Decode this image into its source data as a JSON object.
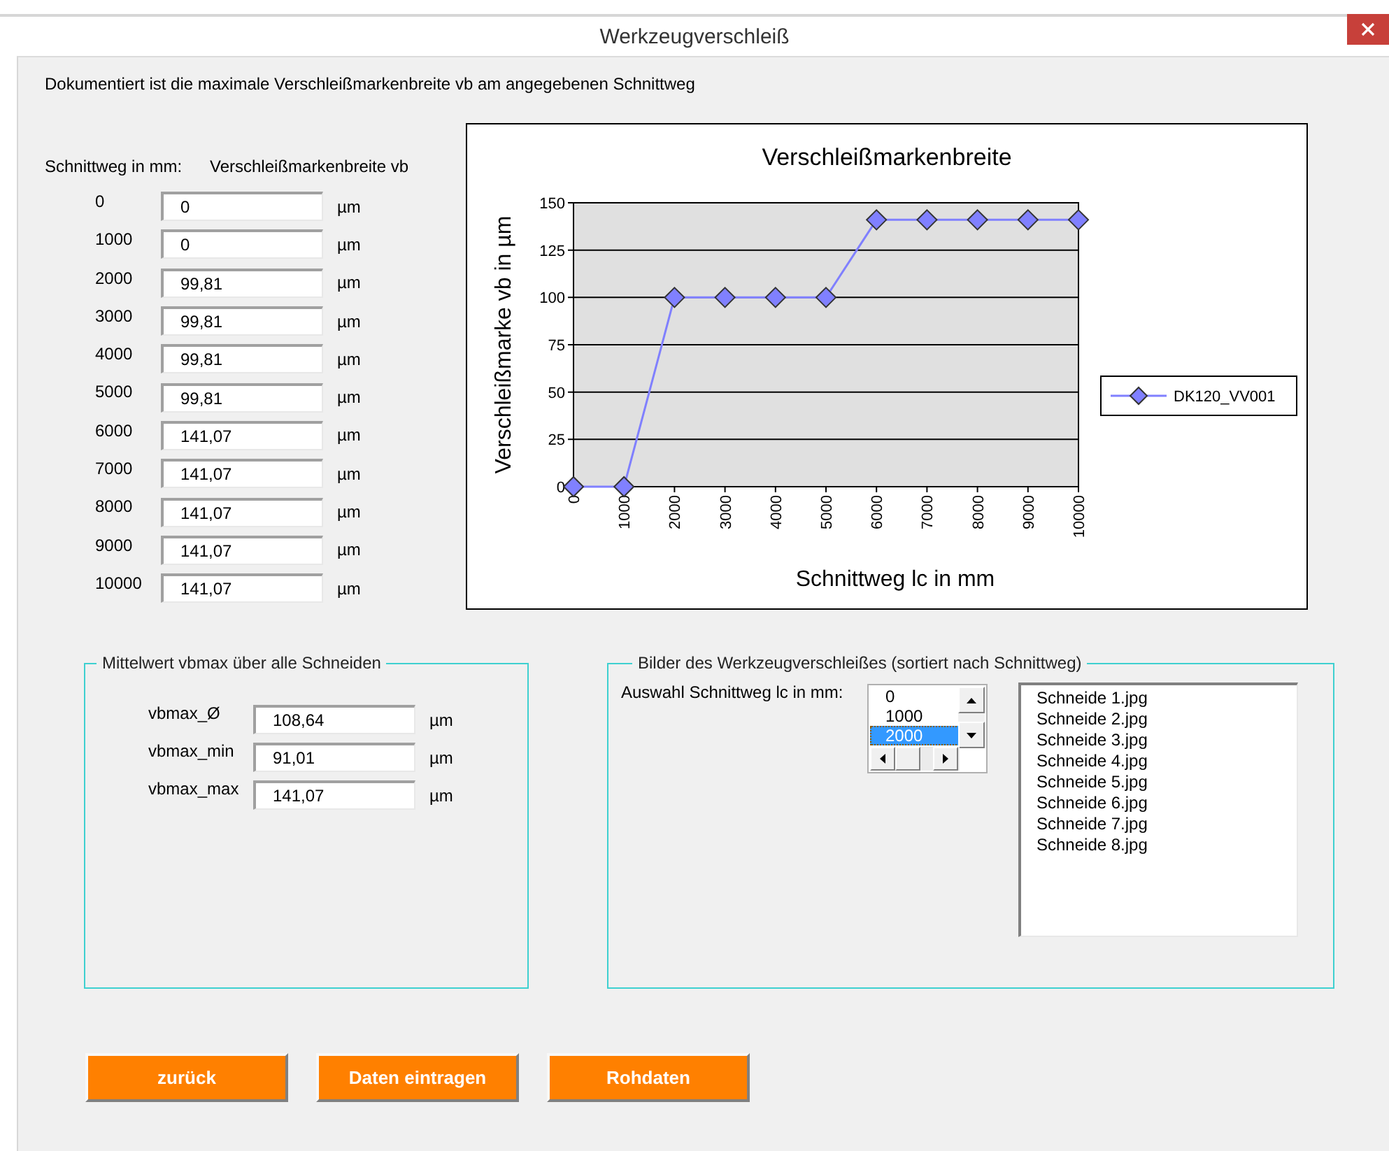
{
  "window": {
    "title": "Werkzeugverschleiß"
  },
  "description": "Dokumentiert ist die maximale Verschleißmarkenbreite vb am angegebenen Schnittweg",
  "table": {
    "columns": [
      "Schnittweg in mm:",
      "Verschleißmarkenbreite vb"
    ],
    "rows": [
      {
        "distance": "0",
        "value": "0",
        "unit": "µm"
      },
      {
        "distance": "1000",
        "value": "0",
        "unit": "µm"
      },
      {
        "distance": "2000",
        "value": "99,81",
        "unit": "µm"
      },
      {
        "distance": "3000",
        "value": "99,81",
        "unit": "µm"
      },
      {
        "distance": "4000",
        "value": "99,81",
        "unit": "µm"
      },
      {
        "distance": "5000",
        "value": "99,81",
        "unit": "µm"
      },
      {
        "distance": "6000",
        "value": "141,07",
        "unit": "µm"
      },
      {
        "distance": "7000",
        "value": "141,07",
        "unit": "µm"
      },
      {
        "distance": "8000",
        "value": "141,07",
        "unit": "µm"
      },
      {
        "distance": "9000",
        "value": "141,07",
        "unit": "µm"
      },
      {
        "distance": "10000",
        "value": "141,07",
        "unit": "µm"
      }
    ]
  },
  "chart": {
    "chart_data": {
      "type": "line",
      "title": "Verschleißmarkenbreite",
      "xlabel": "Schnittweg lc in mm",
      "ylabel": "Verschleißmarke vb in µm",
      "categories": [
        "0",
        "1000",
        "2000",
        "3000",
        "4000",
        "5000",
        "6000",
        "7000",
        "8000",
        "9000",
        "10000"
      ],
      "series": [
        {
          "name": "DK120_VV001",
          "color": "#8080ff",
          "marker": "diamond",
          "values": [
            0,
            0,
            100,
            100,
            100,
            100,
            141,
            141,
            141,
            141,
            141
          ]
        }
      ],
      "grid": true,
      "ylim": [
        0,
        150
      ],
      "yticks": [
        0,
        25,
        50,
        75,
        100,
        125,
        150
      ]
    }
  },
  "average_group": {
    "title": "Mittelwert vbmax über alle Schneiden",
    "fields": [
      {
        "label": "vbmax_Ø",
        "value": "108,64",
        "unit": "µm"
      },
      {
        "label": "vbmax_min",
        "value": "91,01",
        "unit": "µm"
      },
      {
        "label": "vbmax_max",
        "value": "141,07",
        "unit": "µm"
      }
    ]
  },
  "images_group": {
    "title": "Bilder des Werkzeugverschleißes (sortiert nach Schnittweg)",
    "selector_label": "Auswahl Schnittweg lc in mm:",
    "distances": [
      {
        "label": "0",
        "selected": false
      },
      {
        "label": "1000",
        "selected": false
      },
      {
        "label": "2000",
        "selected": true
      }
    ],
    "files": [
      "Schneide 1.jpg",
      "Schneide 2.jpg",
      "Schneide 3.jpg",
      "Schneide 4.jpg",
      "Schneide 5.jpg",
      "Schneide 6.jpg",
      "Schneide 7.jpg",
      "Schneide 8.jpg"
    ]
  },
  "buttons": [
    "zurück",
    "Daten eintragen",
    "Rohdaten"
  ]
}
